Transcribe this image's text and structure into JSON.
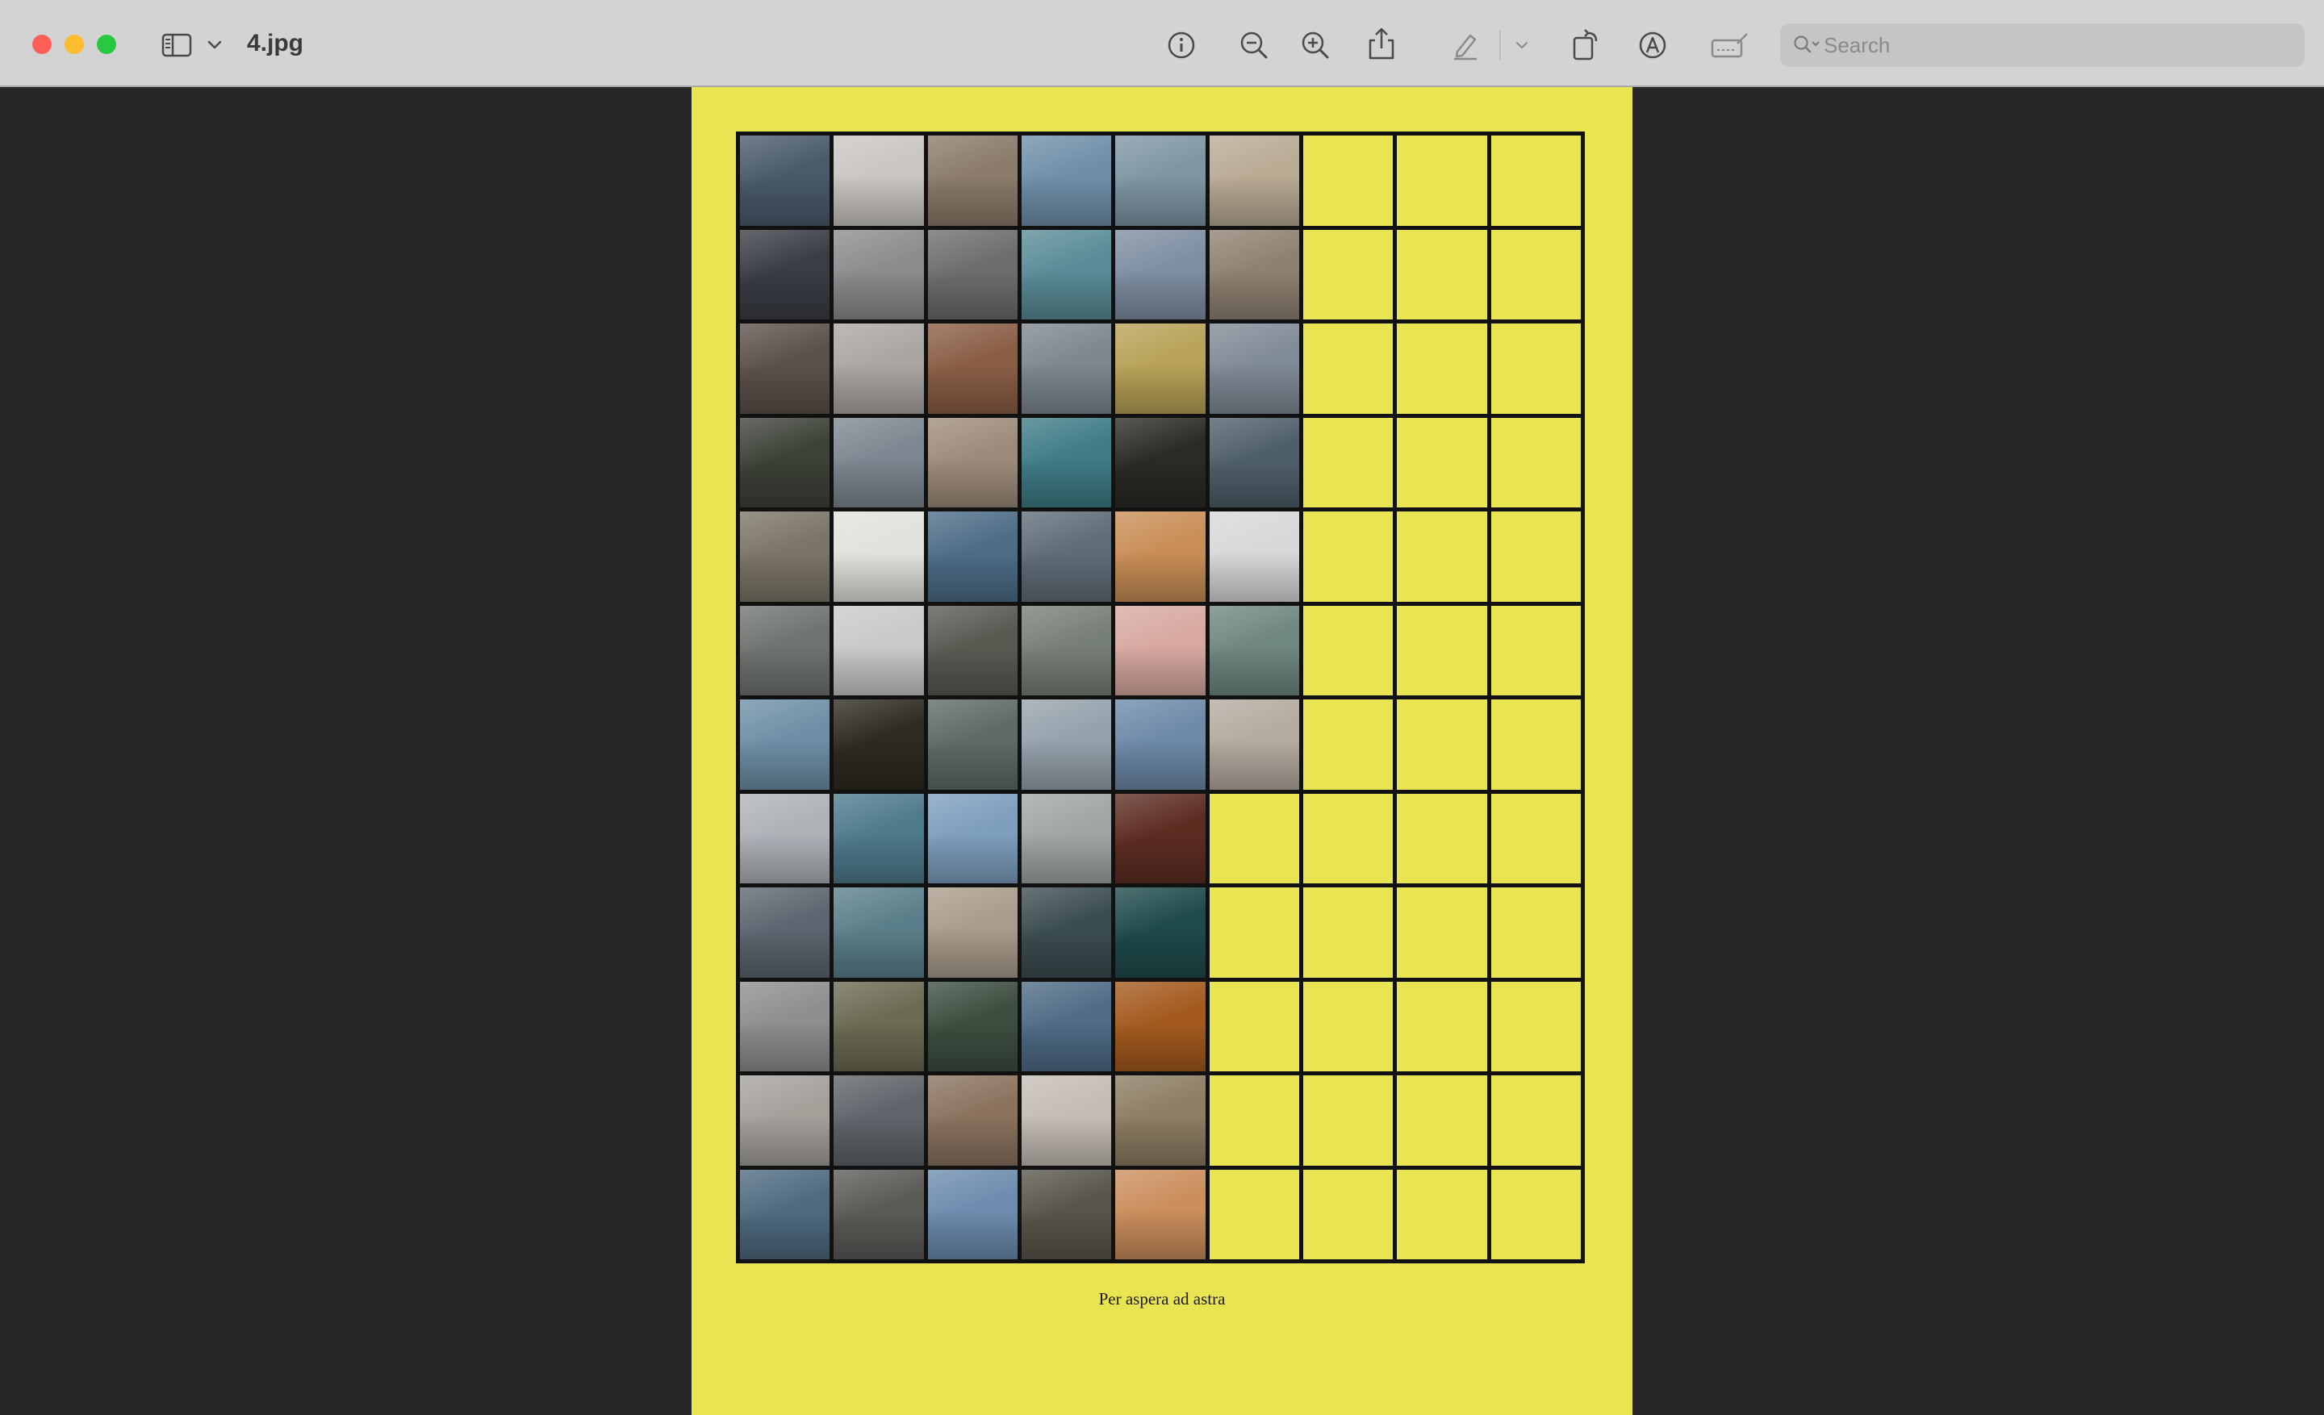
{
  "window": {
    "title": "4.jpg",
    "search_placeholder": "Search"
  },
  "toolbar": {
    "icons": [
      "sidebar-icon",
      "chevron-down-icon",
      "info-icon",
      "zoom-out-icon",
      "zoom-in-icon",
      "share-icon",
      "highlight-pen-icon",
      "chevron-down-icon",
      "rotate-icon",
      "markup-icon",
      "signature-icon",
      "search-icon"
    ]
  },
  "document": {
    "caption": "Per aspera ad astra",
    "background_color": "#e9e552",
    "grid_line_color": "#111111",
    "grid": {
      "columns": 9,
      "rows": 12,
      "photos_per_row": [
        6,
        6,
        6,
        6,
        6,
        6,
        6,
        5,
        5,
        5,
        5,
        5
      ],
      "photo_colors": [
        [
          "#4a5a6a",
          "#c9c6c2",
          "#8a7b6a",
          "#6f8fa8",
          "#7e96a4",
          "#b9ab94"
        ],
        [
          "#3a3d44",
          "#8c8c8e",
          "#6b6e6d",
          "#5a8c97",
          "#7f8ea3",
          "#8f8172"
        ],
        [
          "#5b5149",
          "#aaa6a2",
          "#8a5e45",
          "#7d8790",
          "#b8a257",
          "#7f8b96"
        ],
        [
          "#3d4238",
          "#7d8791",
          "#9d8c7b",
          "#3f7c86",
          "#2b2a25",
          "#4f5f6a"
        ],
        [
          "#7a7566",
          "#e2e2dc",
          "#4d6c86",
          "#5f6d78",
          "#c98e56",
          "#d8d8d8"
        ],
        [
          "#6e7370",
          "#c9c9c9",
          "#585a52",
          "#778076",
          "#d7a9a0",
          "#6f8781"
        ],
        [
          "#6e8fa6",
          "#2e2a22",
          "#5d6a66",
          "#95a2ac",
          "#6d8aa8",
          "#b4ab9f"
        ],
        [
          "#aeb2b7",
          "#4e7a8c",
          "#7d9ebd",
          "#9fa6a5",
          "#5d2d22"
        ],
        [
          "#5b6670",
          "#5b7f8a",
          "#a99c8c",
          "#3c4d50",
          "#1f4a4b"
        ],
        [
          "#8d8e8f",
          "#6b6a52",
          "#3c4e40",
          "#4f6b85",
          "#a45a1e"
        ],
        [
          "#a5a09a",
          "#5e6469",
          "#8a725e",
          "#c4bdb5",
          "#8c7d63"
        ],
        [
          "#4f6a80",
          "#5b5a57",
          "#6d8cae",
          "#58564b",
          "#cb8e5c"
        ]
      ]
    }
  }
}
